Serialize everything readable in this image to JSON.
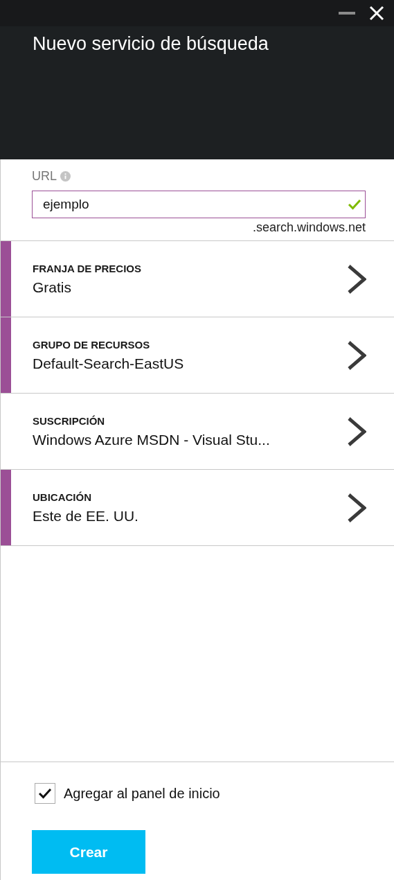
{
  "window": {
    "title": "Nuevo servicio de búsqueda"
  },
  "url_field": {
    "label": "URL",
    "value": "ejemplo",
    "valid": true,
    "suffix": ".search.windows.net"
  },
  "settings": [
    {
      "label": "FRANJA DE PRECIOS",
      "value": "Gratis",
      "required": true
    },
    {
      "label": "GRUPO DE RECURSOS",
      "value": "Default-Search-EastUS",
      "required": true
    },
    {
      "label": "SUSCRIPCIÓN",
      "value": "Windows Azure MSDN - Visual Stu...",
      "required": false
    },
    {
      "label": "UBICACIÓN",
      "value": "Este de EE. UU.",
      "required": true
    }
  ],
  "pin_to_startboard": {
    "label": "Agregar al panel de inicio",
    "checked": true
  },
  "buttons": [
    {
      "label": "Crear"
    }
  ]
}
